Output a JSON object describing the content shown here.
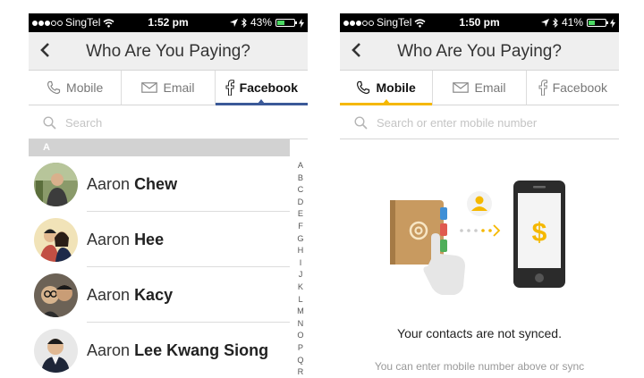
{
  "left": {
    "status": {
      "carrier": "SingTel",
      "time": "1:52 pm",
      "battery": "43%",
      "battery_level": 0.43
    },
    "nav": {
      "title": "Who Are You Paying?"
    },
    "tabs": [
      {
        "label": "Mobile",
        "icon": "phone-icon"
      },
      {
        "label": "Email",
        "icon": "envelope-icon"
      },
      {
        "label": "Facebook",
        "icon": "facebook-icon"
      }
    ],
    "active_tab": "Facebook",
    "search": {
      "placeholder": "Search"
    },
    "section": "A",
    "contacts": [
      {
        "first": "Aaron",
        "last": "Chew"
      },
      {
        "first": "Aaron",
        "last": "Hee"
      },
      {
        "first": "Aaron",
        "last": "Kacy"
      },
      {
        "first": "Aaron",
        "last": "Lee Kwang Siong"
      }
    ],
    "index_letters": [
      "A",
      "B",
      "C",
      "D",
      "E",
      "F",
      "G",
      "H",
      "I",
      "J",
      "K",
      "L",
      "M",
      "N",
      "O",
      "P",
      "Q",
      "R"
    ]
  },
  "right": {
    "status": {
      "carrier": "SingTel",
      "time": "1:50 pm",
      "battery": "41%",
      "battery_level": 0.41
    },
    "nav": {
      "title": "Who Are You Paying?"
    },
    "tabs": [
      {
        "label": "Mobile",
        "icon": "phone-icon"
      },
      {
        "label": "Email",
        "icon": "envelope-icon"
      },
      {
        "label": "Facebook",
        "icon": "facebook-icon"
      }
    ],
    "active_tab": "Mobile",
    "search": {
      "placeholder": "Search or enter mobile number"
    },
    "empty_title": "Your contacts are not synced.",
    "empty_subtitle": "You can enter mobile number above or sync"
  },
  "colors": {
    "facebook_accent": "#3b5998",
    "mobile_accent": "#f5b800",
    "battery_green": "#4cd964"
  }
}
